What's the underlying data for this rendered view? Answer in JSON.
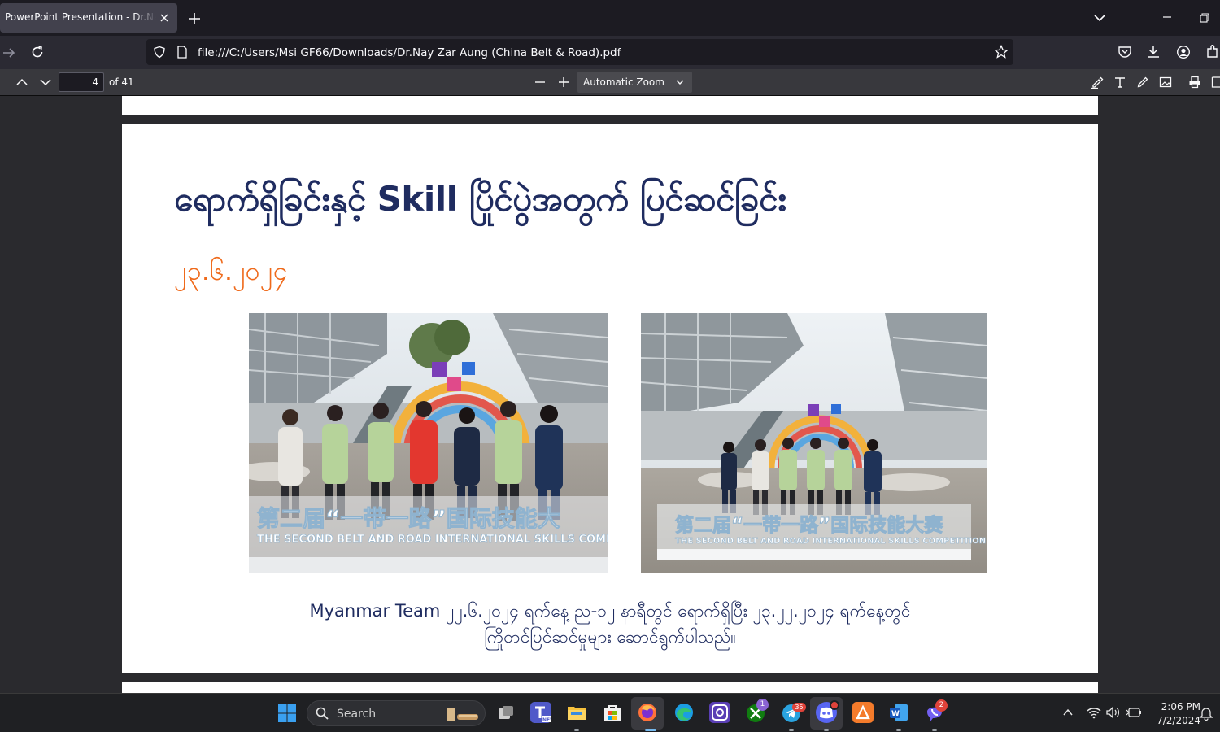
{
  "browser": {
    "tab_title": "PowerPoint Presentation - Dr.Nay Zar Aung",
    "url": "file:///C:/Users/Msi GF66/Downloads/Dr.Nay Zar Aung (China Belt & Road).pdf"
  },
  "pdf_toolbar": {
    "page_number": "4",
    "page_count": "of 41",
    "zoom": "Automatic Zoom"
  },
  "slide": {
    "title": "ရောက်ရှိခြင်းနှင့် Skill ပြိုင်ပွဲအတွက် ပြင်ဆင်ခြင်း",
    "date": "၂၃.၆.၂၀၂၄",
    "caption_line1": "Myanmar Team ၂၂.၆.၂၀၂၄ ရက်နေ့ ည-၁၂ နာရီတွင် ရောက်ရှိပြီး ၂၃.၂၂.၂၀၂၄ ရက်နေ့တွင်",
    "caption_line2": "ကြိုတင်ပြင်ဆင်မှုများ ဆောင်ရွက်ပါသည်။",
    "photo_left_sign_cn": "第二届“一带一路”国际技能大",
    "photo_left_sign_en": "THE SECOND BELT AND ROAD INTERNATIONAL SKILLS COMP",
    "photo_right_sign_cn": "第二届“一带一路”国际技能大赛",
    "photo_right_sign_en": "THE SECOND BELT AND ROAD INTERNATIONAL SKILLS COMPETITION"
  },
  "taskbar": {
    "search_label": "Search",
    "xbox_badge": "1",
    "telegram_badge": "35",
    "viber_badge": "2",
    "time": "2:06 PM",
    "date": "7/2/2024"
  },
  "colors": {
    "title": "#1f2c60",
    "date": "#ef6a1b",
    "viewer_bg": "#2a2a2e"
  }
}
